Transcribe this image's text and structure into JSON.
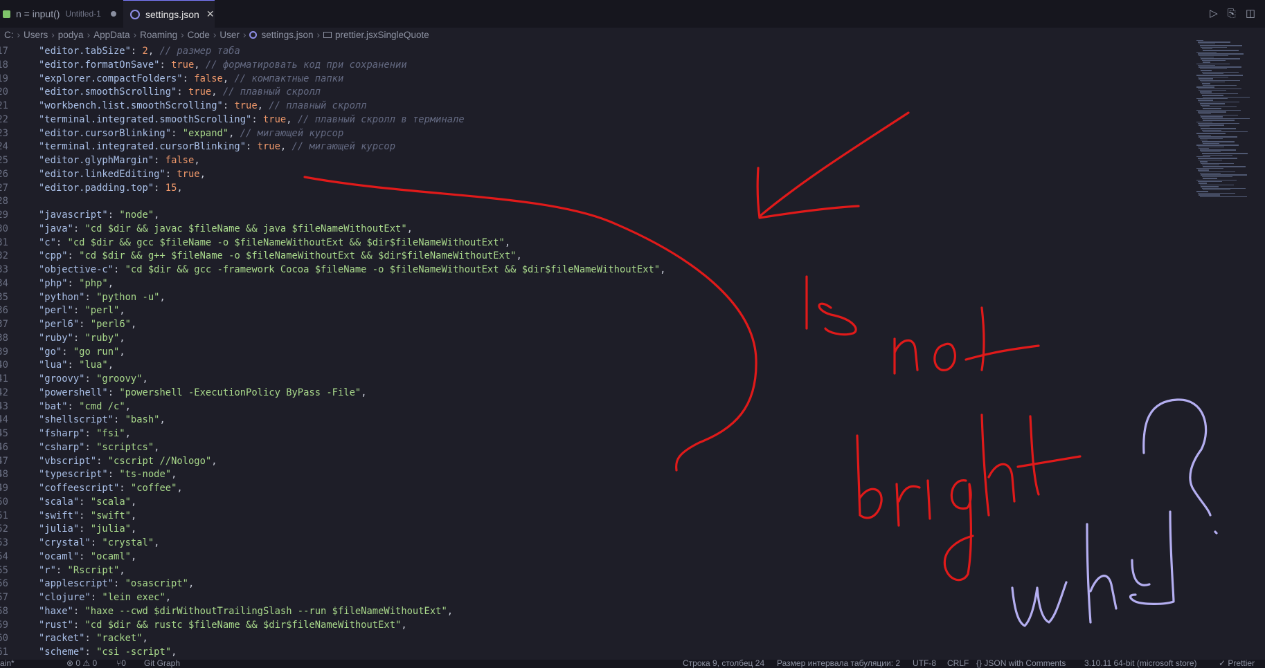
{
  "tabs": [
    {
      "label": "n = input()",
      "sub": "Untitled-1",
      "dirty": true
    },
    {
      "label": "settings.json",
      "active": true
    }
  ],
  "breadcrumb": [
    "C:",
    "Users",
    "podya",
    "AppData",
    "Roaming",
    "Code",
    "User",
    "settings.json",
    "prettier.jsxSingleQuote"
  ],
  "lines": [
    {
      "n": "17",
      "t": [
        [
          "k",
          "\"editor.tabSize\""
        ],
        [
          "p",
          ": "
        ],
        [
          "n",
          "2"
        ],
        [
          "p",
          ", "
        ],
        [
          "c",
          "// размер таба"
        ]
      ]
    },
    {
      "n": "18",
      "t": [
        [
          "k",
          "\"editor.formatOnSave\""
        ],
        [
          "p",
          ": "
        ],
        [
          "n",
          "true"
        ],
        [
          "p",
          ", "
        ],
        [
          "c",
          "// форматировать код при сохранении"
        ]
      ]
    },
    {
      "n": "19",
      "t": [
        [
          "k",
          "\"explorer.compactFolders\""
        ],
        [
          "p",
          ": "
        ],
        [
          "n",
          "false"
        ],
        [
          "p",
          ", "
        ],
        [
          "c",
          "// компактные папки"
        ]
      ]
    },
    {
      "n": "20",
      "t": [
        [
          "k",
          "\"editor.smoothScrolling\""
        ],
        [
          "p",
          ": "
        ],
        [
          "n",
          "true"
        ],
        [
          "p",
          ", "
        ],
        [
          "c",
          "// плавный скролл"
        ]
      ]
    },
    {
      "n": "21",
      "t": [
        [
          "k",
          "\"workbench.list.smoothScrolling\""
        ],
        [
          "p",
          ": "
        ],
        [
          "n",
          "true"
        ],
        [
          "p",
          ", "
        ],
        [
          "c",
          "// плавный скролл"
        ]
      ]
    },
    {
      "n": "22",
      "t": [
        [
          "k",
          "\"terminal.integrated.smoothScrolling\""
        ],
        [
          "p",
          ": "
        ],
        [
          "n",
          "true"
        ],
        [
          "p",
          ", "
        ],
        [
          "c",
          "// плавный скролл в терминале"
        ]
      ]
    },
    {
      "n": "23",
      "t": [
        [
          "k",
          "\"editor.cursorBlinking\""
        ],
        [
          "p",
          ": "
        ],
        [
          "s",
          "\"expand\""
        ],
        [
          "p",
          ", "
        ],
        [
          "c",
          "// мигающей курсор"
        ]
      ]
    },
    {
      "n": "24",
      "t": [
        [
          "k",
          "\"terminal.integrated.cursorBlinking\""
        ],
        [
          "p",
          ": "
        ],
        [
          "n",
          "true"
        ],
        [
          "p",
          ", "
        ],
        [
          "c",
          "// мигающей курсор"
        ]
      ]
    },
    {
      "n": "25",
      "t": [
        [
          "k",
          "\"editor.glyphMargin\""
        ],
        [
          "p",
          ": "
        ],
        [
          "n",
          "false"
        ],
        [
          "p",
          ","
        ]
      ]
    },
    {
      "n": "26",
      "t": [
        [
          "k",
          "\"editor.linkedEditing\""
        ],
        [
          "p",
          ": "
        ],
        [
          "n",
          "true"
        ],
        [
          "p",
          ","
        ]
      ]
    },
    {
      "n": "27",
      "t": [
        [
          "k",
          "\"editor.padding.top\""
        ],
        [
          "p",
          ": "
        ],
        [
          "n",
          "15"
        ],
        [
          "p",
          ","
        ]
      ]
    },
    {
      "n": "28",
      "t": []
    },
    {
      "n": "29",
      "t": [
        [
          "k",
          "\"javascript\""
        ],
        [
          "p",
          ": "
        ],
        [
          "s",
          "\"node\""
        ],
        [
          "p",
          ","
        ]
      ]
    },
    {
      "n": "30",
      "t": [
        [
          "k",
          "\"java\""
        ],
        [
          "p",
          ": "
        ],
        [
          "s",
          "\"cd $dir && javac $fileName && java $fileNameWithoutExt\""
        ],
        [
          "p",
          ","
        ]
      ]
    },
    {
      "n": "31",
      "t": [
        [
          "k",
          "\"c\""
        ],
        [
          "p",
          ": "
        ],
        [
          "s",
          "\"cd $dir && gcc $fileName -o $fileNameWithoutExt && $dir$fileNameWithoutExt\""
        ],
        [
          "p",
          ","
        ]
      ]
    },
    {
      "n": "32",
      "t": [
        [
          "k",
          "\"cpp\""
        ],
        [
          "p",
          ": "
        ],
        [
          "s",
          "\"cd $dir && g++ $fileName -o $fileNameWithoutExt && $dir$fileNameWithoutExt\""
        ],
        [
          "p",
          ","
        ]
      ]
    },
    {
      "n": "33",
      "t": [
        [
          "k",
          "\"objective-c\""
        ],
        [
          "p",
          ": "
        ],
        [
          "s",
          "\"cd $dir && gcc -framework Cocoa $fileName -o $fileNameWithoutExt && $dir$fileNameWithoutExt\""
        ],
        [
          "p",
          ","
        ]
      ]
    },
    {
      "n": "34",
      "t": [
        [
          "k",
          "\"php\""
        ],
        [
          "p",
          ": "
        ],
        [
          "s",
          "\"php\""
        ],
        [
          "p",
          ","
        ]
      ]
    },
    {
      "n": "35",
      "t": [
        [
          "k",
          "\"python\""
        ],
        [
          "p",
          ": "
        ],
        [
          "s",
          "\"python -u\""
        ],
        [
          "p",
          ","
        ]
      ]
    },
    {
      "n": "36",
      "t": [
        [
          "k",
          "\"perl\""
        ],
        [
          "p",
          ": "
        ],
        [
          "s",
          "\"perl\""
        ],
        [
          "p",
          ","
        ]
      ]
    },
    {
      "n": "37",
      "t": [
        [
          "k",
          "\"perl6\""
        ],
        [
          "p",
          ": "
        ],
        [
          "s",
          "\"perl6\""
        ],
        [
          "p",
          ","
        ]
      ]
    },
    {
      "n": "38",
      "t": [
        [
          "k",
          "\"ruby\""
        ],
        [
          "p",
          ": "
        ],
        [
          "s",
          "\"ruby\""
        ],
        [
          "p",
          ","
        ]
      ]
    },
    {
      "n": "39",
      "t": [
        [
          "k",
          "\"go\""
        ],
        [
          "p",
          ": "
        ],
        [
          "s",
          "\"go run\""
        ],
        [
          "p",
          ","
        ]
      ]
    },
    {
      "n": "40",
      "t": [
        [
          "k",
          "\"lua\""
        ],
        [
          "p",
          ": "
        ],
        [
          "s",
          "\"lua\""
        ],
        [
          "p",
          ","
        ]
      ]
    },
    {
      "n": "41",
      "t": [
        [
          "k",
          "\"groovy\""
        ],
        [
          "p",
          ": "
        ],
        [
          "s",
          "\"groovy\""
        ],
        [
          "p",
          ","
        ]
      ]
    },
    {
      "n": "42",
      "t": [
        [
          "k",
          "\"powershell\""
        ],
        [
          "p",
          ": "
        ],
        [
          "s",
          "\"powershell -ExecutionPolicy ByPass -File\""
        ],
        [
          "p",
          ","
        ]
      ]
    },
    {
      "n": "43",
      "t": [
        [
          "k",
          "\"bat\""
        ],
        [
          "p",
          ": "
        ],
        [
          "s",
          "\"cmd /c\""
        ],
        [
          "p",
          ","
        ]
      ]
    },
    {
      "n": "44",
      "t": [
        [
          "k",
          "\"shellscript\""
        ],
        [
          "p",
          ": "
        ],
        [
          "s",
          "\"bash\""
        ],
        [
          "p",
          ","
        ]
      ]
    },
    {
      "n": "45",
      "t": [
        [
          "k",
          "\"fsharp\""
        ],
        [
          "p",
          ": "
        ],
        [
          "s",
          "\"fsi\""
        ],
        [
          "p",
          ","
        ]
      ]
    },
    {
      "n": "46",
      "t": [
        [
          "k",
          "\"csharp\""
        ],
        [
          "p",
          ": "
        ],
        [
          "s",
          "\"scriptcs\""
        ],
        [
          "p",
          ","
        ]
      ]
    },
    {
      "n": "47",
      "t": [
        [
          "k",
          "\"vbscript\""
        ],
        [
          "p",
          ": "
        ],
        [
          "s",
          "\"cscript //Nologo\""
        ],
        [
          "p",
          ","
        ]
      ]
    },
    {
      "n": "48",
      "t": [
        [
          "k",
          "\"typescript\""
        ],
        [
          "p",
          ": "
        ],
        [
          "s",
          "\"ts-node\""
        ],
        [
          "p",
          ","
        ]
      ]
    },
    {
      "n": "49",
      "t": [
        [
          "k",
          "\"coffeescript\""
        ],
        [
          "p",
          ": "
        ],
        [
          "s",
          "\"coffee\""
        ],
        [
          "p",
          ","
        ]
      ]
    },
    {
      "n": "50",
      "t": [
        [
          "k",
          "\"scala\""
        ],
        [
          "p",
          ": "
        ],
        [
          "s",
          "\"scala\""
        ],
        [
          "p",
          ","
        ]
      ]
    },
    {
      "n": "51",
      "t": [
        [
          "k",
          "\"swift\""
        ],
        [
          "p",
          ": "
        ],
        [
          "s",
          "\"swift\""
        ],
        [
          "p",
          ","
        ]
      ]
    },
    {
      "n": "52",
      "t": [
        [
          "k",
          "\"julia\""
        ],
        [
          "p",
          ": "
        ],
        [
          "s",
          "\"julia\""
        ],
        [
          "p",
          ","
        ]
      ]
    },
    {
      "n": "53",
      "t": [
        [
          "k",
          "\"crystal\""
        ],
        [
          "p",
          ": "
        ],
        [
          "s",
          "\"crystal\""
        ],
        [
          "p",
          ","
        ]
      ]
    },
    {
      "n": "54",
      "t": [
        [
          "k",
          "\"ocaml\""
        ],
        [
          "p",
          ": "
        ],
        [
          "s",
          "\"ocaml\""
        ],
        [
          "p",
          ","
        ]
      ]
    },
    {
      "n": "55",
      "t": [
        [
          "k",
          "\"r\""
        ],
        [
          "p",
          ": "
        ],
        [
          "s",
          "\"Rscript\""
        ],
        [
          "p",
          ","
        ]
      ]
    },
    {
      "n": "56",
      "t": [
        [
          "k",
          "\"applescript\""
        ],
        [
          "p",
          ": "
        ],
        [
          "s",
          "\"osascript\""
        ],
        [
          "p",
          ","
        ]
      ]
    },
    {
      "n": "57",
      "t": [
        [
          "k",
          "\"clojure\""
        ],
        [
          "p",
          ": "
        ],
        [
          "s",
          "\"lein exec\""
        ],
        [
          "p",
          ","
        ]
      ]
    },
    {
      "n": "58",
      "t": [
        [
          "k",
          "\"haxe\""
        ],
        [
          "p",
          ": "
        ],
        [
          "s",
          "\"haxe --cwd $dirWithoutTrailingSlash --run $fileNameWithoutExt\""
        ],
        [
          "p",
          ","
        ]
      ]
    },
    {
      "n": "59",
      "t": [
        [
          "k",
          "\"rust\""
        ],
        [
          "p",
          ": "
        ],
        [
          "s",
          "\"cd $dir && rustc $fileName && $dir$fileNameWithoutExt\""
        ],
        [
          "p",
          ","
        ]
      ]
    },
    {
      "n": "60",
      "t": [
        [
          "k",
          "\"racket\""
        ],
        [
          "p",
          ": "
        ],
        [
          "s",
          "\"racket\""
        ],
        [
          "p",
          ","
        ]
      ]
    },
    {
      "n": "61",
      "t": [
        [
          "k",
          "\"scheme\""
        ],
        [
          "p",
          ": "
        ],
        [
          "s",
          "\"csi -script\""
        ],
        [
          "p",
          ","
        ]
      ]
    }
  ],
  "statusbar": {
    "left": [
      "ain*",
      "⊗ 0 ⚠ 0",
      "⑂0",
      "Git Graph"
    ],
    "right": [
      "Строка 9, столбец 24",
      "Размер интервала табуляции: 2",
      "UTF-8",
      "CRLF",
      "{} JSON with Comments",
      "3.10.11 64-bit (microsoft store)",
      "✓ Prettier"
    ]
  },
  "annotation": {
    "red_color": "#e01a1a",
    "purple_color": "#b4aef0"
  }
}
